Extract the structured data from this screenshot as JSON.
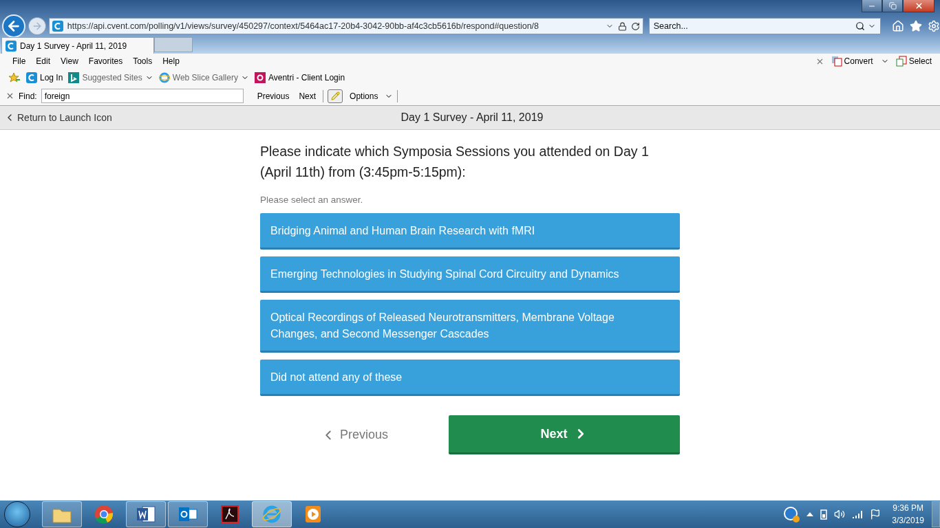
{
  "browser": {
    "address": "https://api.cvent.com/polling/v1/views/survey/450297/context/5464ac17-20b4-3042-90bb-af4c3cb5616b/respond#question/8",
    "search_placeholder": "Search...",
    "tabs": [
      {
        "label": "Day 1 Survey - April 11, 2019",
        "selected": true
      }
    ],
    "menu": [
      "File",
      "Edit",
      "View",
      "Favorites",
      "Tools",
      "Help"
    ],
    "favorites": [
      {
        "label": "Log In",
        "kind": "cvent",
        "dropdown": false
      },
      {
        "label": "Suggested Sites",
        "kind": "bing",
        "dropdown": true
      },
      {
        "label": "Web Slice Gallery",
        "kind": "ie",
        "dropdown": true
      },
      {
        "label": "Aventri - Client Login",
        "kind": "aventri",
        "dropdown": false
      }
    ],
    "find": {
      "label": "Find:",
      "value": "foreign",
      "buttons": [
        "Previous",
        "Next"
      ],
      "options": "Options"
    },
    "addons": [
      {
        "label": "Convert",
        "kind": "pdf"
      },
      {
        "label": "Select",
        "kind": "select"
      }
    ]
  },
  "page": {
    "back": "Return to Launch Icon",
    "title": "Day 1 Survey - April 11, 2019",
    "question": "Please indicate which Symposia Sessions you attended on Day 1 (April 11th) from (3:45pm-5:15pm):",
    "hint": "Please select an answer.",
    "answers": [
      {
        "label": "Bridging Animal and Human Brain Research with fMRI",
        "selected": false
      },
      {
        "label": "Emerging Technologies in Studying Spinal Cord Circuitry and Dynamics",
        "selected": false
      },
      {
        "label": "Optical Recordings of Released Neurotransmitters, Membrane Voltage Changes, and Second Messenger Cascades",
        "selected": false
      },
      {
        "label": "Did not attend any of these",
        "selected": false
      }
    ],
    "previous": "Previous",
    "next": "Next"
  },
  "taskbar": {
    "apps": [
      {
        "kind": "folder",
        "running": true,
        "selected": false
      },
      {
        "kind": "chrome",
        "running": false,
        "selected": false
      },
      {
        "kind": "word",
        "running": true,
        "selected": false
      },
      {
        "kind": "outlook",
        "running": true,
        "selected": false
      },
      {
        "kind": "acrobat",
        "running": false,
        "selected": false
      },
      {
        "kind": "ie",
        "running": true,
        "selected": true
      },
      {
        "kind": "media",
        "running": false,
        "selected": false
      }
    ],
    "time": "9:36 PM",
    "date": "3/3/2019"
  }
}
